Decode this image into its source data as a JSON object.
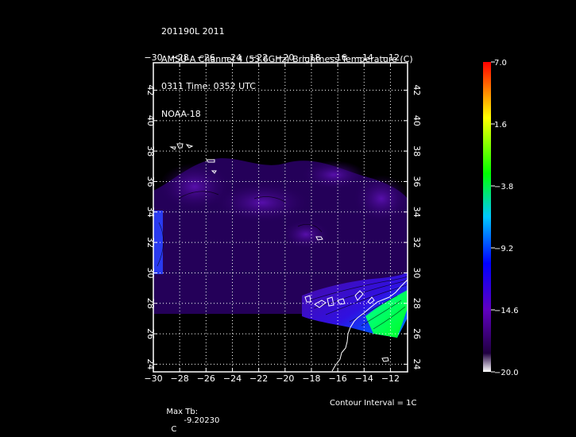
{
  "header": {
    "line1": "201190L 2011",
    "line2": "AMSU-A Channel 4 (53.6GHz) Brightness Temperature (C)",
    "line3": "0311 Time: 0352 UTC",
    "line4": "NOAA-18"
  },
  "footer": {
    "max_label": "Max Tb:",
    "max_value": "-9.20230",
    "max_unit": "C",
    "contour": "Contour Interval = 1C"
  },
  "colorbar": {
    "ticks": [
      "7.0",
      "1.6",
      "-3.8",
      "-9.2",
      "-14.6",
      "-20.0"
    ],
    "colors": [
      "#ff0000",
      "#ffff00",
      "#00ff00",
      "#00c8ff",
      "#0000ff",
      "#8000ff",
      "#200040"
    ]
  },
  "chart_data": {
    "type": "heatmap",
    "title": "AMSU-A Channel 4 (53.6GHz) Brightness Temperature (C)",
    "xlabel": "",
    "ylabel": "",
    "x_ticks": [
      -30,
      -28,
      -26,
      -24,
      -22,
      -20,
      -18,
      -16,
      -14,
      -12
    ],
    "y_ticks": [
      24,
      26,
      28,
      30,
      32,
      34,
      36,
      38,
      40,
      42
    ],
    "xlim": [
      -30,
      -10.7
    ],
    "ylim": [
      23.5,
      43.8
    ],
    "color_range": [
      -20.0,
      7.0
    ],
    "max_tb": -9.2023,
    "contour_interval": 1,
    "grid": true
  }
}
